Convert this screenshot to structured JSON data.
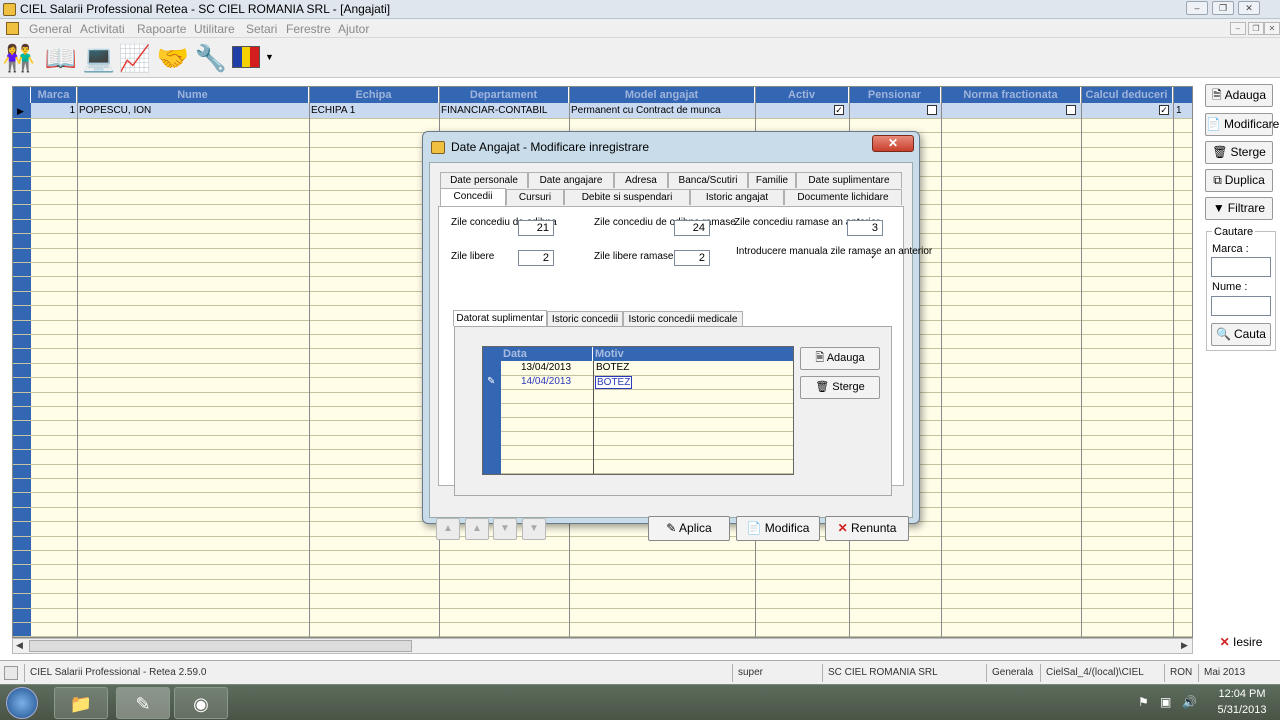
{
  "window": {
    "title": "CIEL Salarii Professional Retea - SC CIEL ROMANIA SRL  - [Angajati]"
  },
  "menu": [
    "General",
    "Activitati",
    "Rapoarte",
    "Utilitare",
    "Setari",
    "Ferestre",
    "Ajutor"
  ],
  "grid": {
    "columns": [
      "Marca",
      "Nume",
      "Echipa",
      "Departament",
      "Model angajat",
      "Activ",
      "Pensionar",
      "Norma fractionata",
      "Calcul deduceri"
    ],
    "row": {
      "marca": "1",
      "nume": "POPESCU, ION",
      "echipa": "ECHIPA 1",
      "departament": "FINANCIAR-CONTABIL",
      "model": "Permanent cu Contract de munca",
      "activ": true,
      "pensionar": false,
      "norma": false,
      "deduceri": true,
      "extra": "1"
    }
  },
  "right_panel": {
    "adauga": "Adauga",
    "modificare": "Modificare",
    "sterge": "Sterge",
    "duplica": "Duplica",
    "filtrare": "Filtrare",
    "cautare_title": "Cautare",
    "marca_label": "Marca :",
    "nume_label": "Nume :",
    "cauta": "Cauta",
    "iesire": "Iesire"
  },
  "status": {
    "app": "CIEL Salarii Professional - Retea 2.59.0",
    "user": "super",
    "company": "SC CIEL ROMANIA SRL",
    "mode": "Generala",
    "db": "CielSal_4/(local)\\CIEL",
    "currency": "RON",
    "period": "Mai 2013"
  },
  "taskbar": {
    "time": "12:04 PM",
    "date": "5/31/2013"
  },
  "dialog": {
    "title": "Date Angajat - Modificare inregistrare",
    "tabs_row1": [
      "Date personale",
      "Date angajare",
      "Adresa",
      "Banca/Scutiri",
      "Familie",
      "Date suplimentare"
    ],
    "tabs_row2": [
      "Concedii",
      "Cursuri",
      "Debite si suspendari",
      "Istoric angajat",
      "Documente lichidare"
    ],
    "fields": {
      "zile_co_label": "Zile concediu de odihna",
      "zile_co": "21",
      "zile_co_ramase_label": "Zile concediu de odihna ramase",
      "zile_co_ramase": "24",
      "zile_co_anterior_label": "Zile concediu ramase an anterior",
      "zile_co_anterior": "3",
      "zile_libere_label": "Zile libere",
      "zile_libere": "2",
      "zile_libere_ramase_label": "Zile libere ramase",
      "zile_libere_ramase": "2",
      "intro_manuala_label": "Introducere manuala zile ramase an anterior",
      "intro_manuala": true
    },
    "subtabs": [
      "Datorat suplimentar",
      "Istoric concedii",
      "Istoric concedii medicale"
    ],
    "subgrid": {
      "columns": [
        "Data",
        "Motiv"
      ],
      "rows": [
        {
          "data": "13/04/2013",
          "motiv": "BOTEZ"
        },
        {
          "data": "14/04/2013",
          "motiv": "BOTEZ"
        }
      ]
    },
    "sub_adauga": "Adauga",
    "sub_sterge": "Sterge",
    "aplica": "Aplica",
    "modifica": "Modifica",
    "renunta": "Renunta"
  }
}
